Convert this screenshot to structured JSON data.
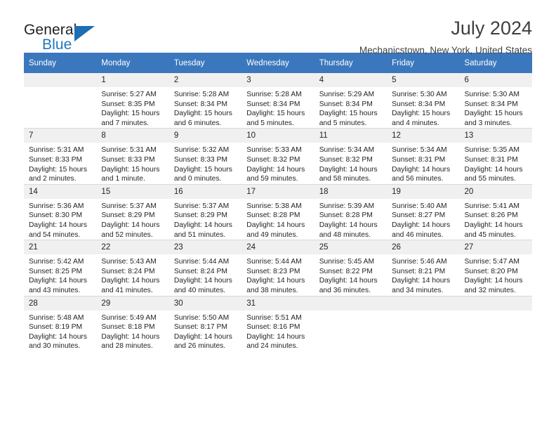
{
  "brand": {
    "name_top": "General",
    "name_bottom": "Blue",
    "accent_color": "#1a6fb5",
    "logo_icon": "triangle-flag-icon"
  },
  "header": {
    "title": "July 2024",
    "subtitle": "Mechanicstown, New York, United States"
  },
  "theme": {
    "header_bg": "#3b77bd",
    "header_text": "#ffffff",
    "daynum_bg": "#f0f0f0",
    "row_divider": "#d9d9d9"
  },
  "weekdays": [
    "Sunday",
    "Monday",
    "Tuesday",
    "Wednesday",
    "Thursday",
    "Friday",
    "Saturday"
  ],
  "weeks": [
    [
      {
        "day": "",
        "empty": true
      },
      {
        "day": "1",
        "sunrise": "Sunrise: 5:27 AM",
        "sunset": "Sunset: 8:35 PM",
        "daylight1": "Daylight: 15 hours",
        "daylight2": "and 7 minutes."
      },
      {
        "day": "2",
        "sunrise": "Sunrise: 5:28 AM",
        "sunset": "Sunset: 8:34 PM",
        "daylight1": "Daylight: 15 hours",
        "daylight2": "and 6 minutes."
      },
      {
        "day": "3",
        "sunrise": "Sunrise: 5:28 AM",
        "sunset": "Sunset: 8:34 PM",
        "daylight1": "Daylight: 15 hours",
        "daylight2": "and 5 minutes."
      },
      {
        "day": "4",
        "sunrise": "Sunrise: 5:29 AM",
        "sunset": "Sunset: 8:34 PM",
        "daylight1": "Daylight: 15 hours",
        "daylight2": "and 5 minutes."
      },
      {
        "day": "5",
        "sunrise": "Sunrise: 5:30 AM",
        "sunset": "Sunset: 8:34 PM",
        "daylight1": "Daylight: 15 hours",
        "daylight2": "and 4 minutes."
      },
      {
        "day": "6",
        "sunrise": "Sunrise: 5:30 AM",
        "sunset": "Sunset: 8:34 PM",
        "daylight1": "Daylight: 15 hours",
        "daylight2": "and 3 minutes."
      }
    ],
    [
      {
        "day": "7",
        "sunrise": "Sunrise: 5:31 AM",
        "sunset": "Sunset: 8:33 PM",
        "daylight1": "Daylight: 15 hours",
        "daylight2": "and 2 minutes."
      },
      {
        "day": "8",
        "sunrise": "Sunrise: 5:31 AM",
        "sunset": "Sunset: 8:33 PM",
        "daylight1": "Daylight: 15 hours",
        "daylight2": "and 1 minute."
      },
      {
        "day": "9",
        "sunrise": "Sunrise: 5:32 AM",
        "sunset": "Sunset: 8:33 PM",
        "daylight1": "Daylight: 15 hours",
        "daylight2": "and 0 minutes."
      },
      {
        "day": "10",
        "sunrise": "Sunrise: 5:33 AM",
        "sunset": "Sunset: 8:32 PM",
        "daylight1": "Daylight: 14 hours",
        "daylight2": "and 59 minutes."
      },
      {
        "day": "11",
        "sunrise": "Sunrise: 5:34 AM",
        "sunset": "Sunset: 8:32 PM",
        "daylight1": "Daylight: 14 hours",
        "daylight2": "and 58 minutes."
      },
      {
        "day": "12",
        "sunrise": "Sunrise: 5:34 AM",
        "sunset": "Sunset: 8:31 PM",
        "daylight1": "Daylight: 14 hours",
        "daylight2": "and 56 minutes."
      },
      {
        "day": "13",
        "sunrise": "Sunrise: 5:35 AM",
        "sunset": "Sunset: 8:31 PM",
        "daylight1": "Daylight: 14 hours",
        "daylight2": "and 55 minutes."
      }
    ],
    [
      {
        "day": "14",
        "sunrise": "Sunrise: 5:36 AM",
        "sunset": "Sunset: 8:30 PM",
        "daylight1": "Daylight: 14 hours",
        "daylight2": "and 54 minutes."
      },
      {
        "day": "15",
        "sunrise": "Sunrise: 5:37 AM",
        "sunset": "Sunset: 8:29 PM",
        "daylight1": "Daylight: 14 hours",
        "daylight2": "and 52 minutes."
      },
      {
        "day": "16",
        "sunrise": "Sunrise: 5:37 AM",
        "sunset": "Sunset: 8:29 PM",
        "daylight1": "Daylight: 14 hours",
        "daylight2": "and 51 minutes."
      },
      {
        "day": "17",
        "sunrise": "Sunrise: 5:38 AM",
        "sunset": "Sunset: 8:28 PM",
        "daylight1": "Daylight: 14 hours",
        "daylight2": "and 49 minutes."
      },
      {
        "day": "18",
        "sunrise": "Sunrise: 5:39 AM",
        "sunset": "Sunset: 8:28 PM",
        "daylight1": "Daylight: 14 hours",
        "daylight2": "and 48 minutes."
      },
      {
        "day": "19",
        "sunrise": "Sunrise: 5:40 AM",
        "sunset": "Sunset: 8:27 PM",
        "daylight1": "Daylight: 14 hours",
        "daylight2": "and 46 minutes."
      },
      {
        "day": "20",
        "sunrise": "Sunrise: 5:41 AM",
        "sunset": "Sunset: 8:26 PM",
        "daylight1": "Daylight: 14 hours",
        "daylight2": "and 45 minutes."
      }
    ],
    [
      {
        "day": "21",
        "sunrise": "Sunrise: 5:42 AM",
        "sunset": "Sunset: 8:25 PM",
        "daylight1": "Daylight: 14 hours",
        "daylight2": "and 43 minutes."
      },
      {
        "day": "22",
        "sunrise": "Sunrise: 5:43 AM",
        "sunset": "Sunset: 8:24 PM",
        "daylight1": "Daylight: 14 hours",
        "daylight2": "and 41 minutes."
      },
      {
        "day": "23",
        "sunrise": "Sunrise: 5:44 AM",
        "sunset": "Sunset: 8:24 PM",
        "daylight1": "Daylight: 14 hours",
        "daylight2": "and 40 minutes."
      },
      {
        "day": "24",
        "sunrise": "Sunrise: 5:44 AM",
        "sunset": "Sunset: 8:23 PM",
        "daylight1": "Daylight: 14 hours",
        "daylight2": "and 38 minutes."
      },
      {
        "day": "25",
        "sunrise": "Sunrise: 5:45 AM",
        "sunset": "Sunset: 8:22 PM",
        "daylight1": "Daylight: 14 hours",
        "daylight2": "and 36 minutes."
      },
      {
        "day": "26",
        "sunrise": "Sunrise: 5:46 AM",
        "sunset": "Sunset: 8:21 PM",
        "daylight1": "Daylight: 14 hours",
        "daylight2": "and 34 minutes."
      },
      {
        "day": "27",
        "sunrise": "Sunrise: 5:47 AM",
        "sunset": "Sunset: 8:20 PM",
        "daylight1": "Daylight: 14 hours",
        "daylight2": "and 32 minutes."
      }
    ],
    [
      {
        "day": "28",
        "sunrise": "Sunrise: 5:48 AM",
        "sunset": "Sunset: 8:19 PM",
        "daylight1": "Daylight: 14 hours",
        "daylight2": "and 30 minutes."
      },
      {
        "day": "29",
        "sunrise": "Sunrise: 5:49 AM",
        "sunset": "Sunset: 8:18 PM",
        "daylight1": "Daylight: 14 hours",
        "daylight2": "and 28 minutes."
      },
      {
        "day": "30",
        "sunrise": "Sunrise: 5:50 AM",
        "sunset": "Sunset: 8:17 PM",
        "daylight1": "Daylight: 14 hours",
        "daylight2": "and 26 minutes."
      },
      {
        "day": "31",
        "sunrise": "Sunrise: 5:51 AM",
        "sunset": "Sunset: 8:16 PM",
        "daylight1": "Daylight: 14 hours",
        "daylight2": "and 24 minutes."
      },
      {
        "day": "",
        "empty": true
      },
      {
        "day": "",
        "empty": true
      },
      {
        "day": "",
        "empty": true
      }
    ]
  ]
}
